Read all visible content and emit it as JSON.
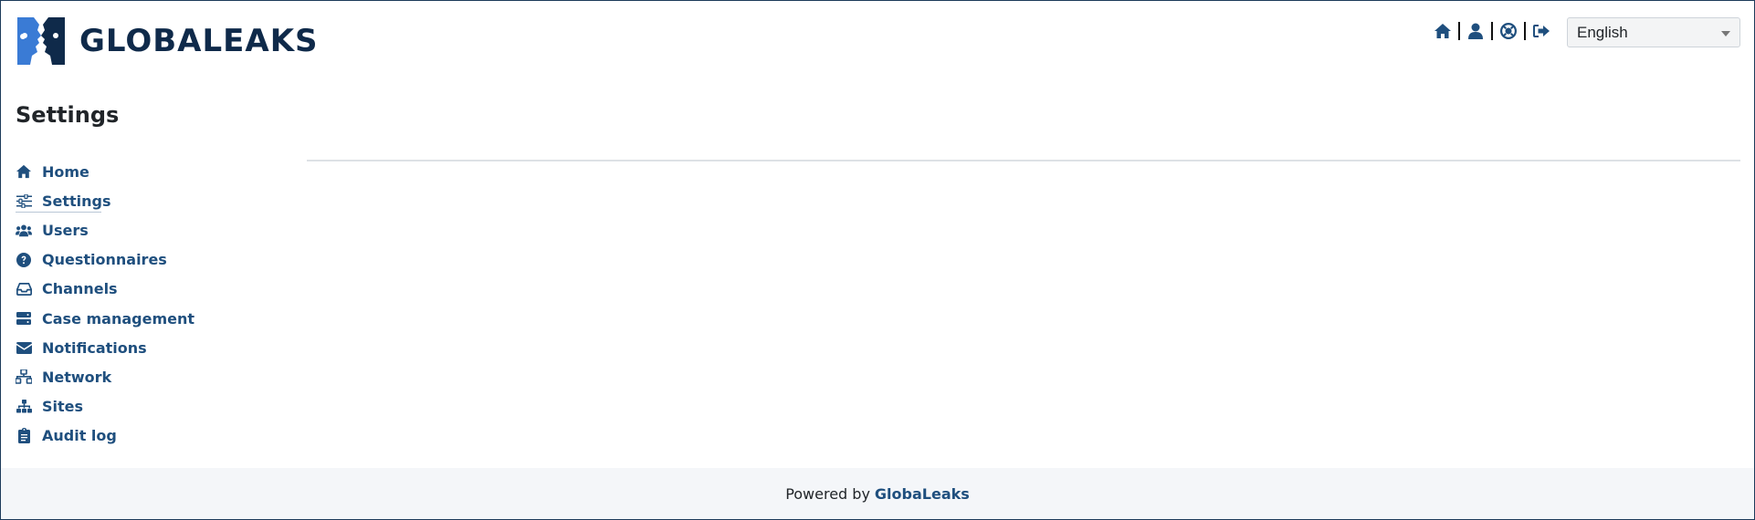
{
  "app": {
    "logo_text": "GLOBALEAKS"
  },
  "header": {
    "icons": [
      "home-icon",
      "user-icon",
      "support-icon",
      "logout-icon"
    ],
    "language": "English"
  },
  "page": {
    "title": "Settings"
  },
  "sidebar": {
    "items": [
      {
        "label": "Home",
        "icon": "home-icon"
      },
      {
        "label": "Settings",
        "icon": "sliders-icon",
        "active": true
      },
      {
        "label": "Users",
        "icon": "users-icon"
      },
      {
        "label": "Questionnaires",
        "icon": "question-circle-icon"
      },
      {
        "label": "Channels",
        "icon": "inbox-icon"
      },
      {
        "label": "Case management",
        "icon": "server-icon"
      },
      {
        "label": "Notifications",
        "icon": "envelope-icon"
      },
      {
        "label": "Network",
        "icon": "network-icon"
      },
      {
        "label": "Sites",
        "icon": "sitemap-icon"
      },
      {
        "label": "Audit log",
        "icon": "clipboard-icon"
      }
    ]
  },
  "footer": {
    "prefix": "Powered by",
    "brand": "GlobaLeaks"
  },
  "colors": {
    "primary": "#1f4f7e",
    "logo": "#0f2a4a",
    "logo_accent": "#3a7bd5",
    "footer_bg": "#f4f6f9"
  }
}
